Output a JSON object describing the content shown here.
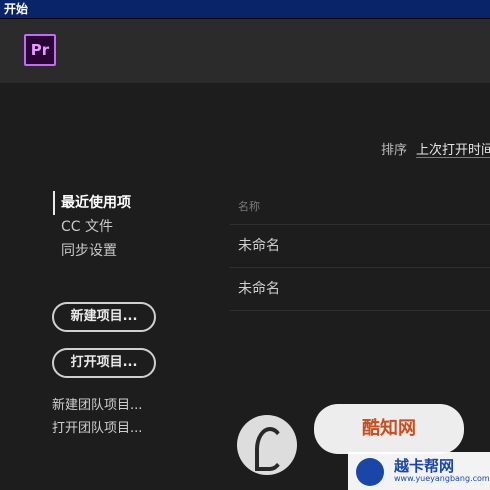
{
  "window": {
    "title": "开始"
  },
  "app": {
    "logo_text": "Pr",
    "accent": "#c56af6"
  },
  "sort": {
    "label": "排序",
    "selected": "上次打开时间"
  },
  "nav": {
    "items": [
      {
        "label": "最近使用项"
      },
      {
        "label": "CC 文件"
      },
      {
        "label": "同步设置"
      }
    ]
  },
  "actions": {
    "new_project": "新建项目...",
    "open_project": "打开项目...",
    "new_team_project": "新建团队项目...",
    "open_team_project": "打开团队项目..."
  },
  "recent": {
    "column_name": "名称",
    "rows": [
      "未命名",
      "未命名"
    ]
  },
  "watermarks": {
    "site1": "酷知网",
    "site2": "越卡帮网",
    "site2_url": "www.yueyangbang.com"
  }
}
